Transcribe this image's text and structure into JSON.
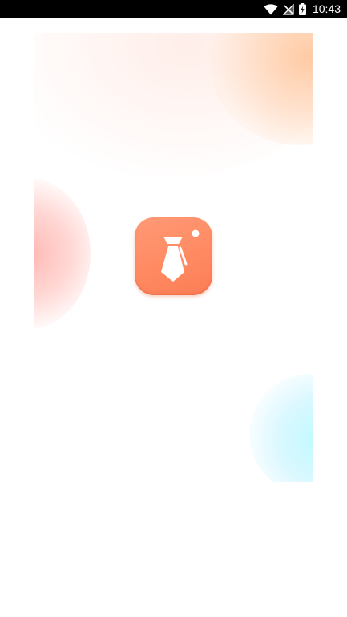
{
  "status_bar": {
    "time": "10:43",
    "icons": [
      "wifi-icon",
      "no-signal-icon",
      "battery-charging-icon"
    ]
  },
  "splash": {
    "logo_icon": "necktie-icon",
    "colors": {
      "logo_top": "#ff9a76",
      "logo_bottom": "#fb7d55",
      "peach": "#ffc8a0",
      "pink": "#ffafaa",
      "cyan": "#b9faff"
    }
  }
}
